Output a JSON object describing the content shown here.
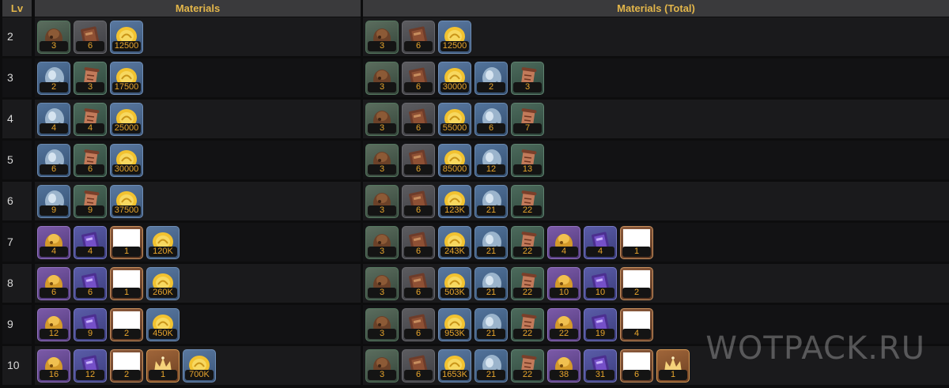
{
  "headers": {
    "lv": "Lv",
    "materials": "Materials",
    "total": "Materials (Total)"
  },
  "watermark": "WOTPACK.RU",
  "rows": [
    {
      "lv": "2",
      "materials": [
        [
          "bag",
          "3"
        ],
        [
          "book",
          "6"
        ],
        [
          "coin",
          "12500"
        ]
      ],
      "total": [
        [
          "bag",
          "3"
        ],
        [
          "book",
          "6"
        ],
        [
          "coin",
          "12500"
        ]
      ]
    },
    {
      "lv": "3",
      "materials": [
        [
          "scale",
          "2"
        ],
        [
          "scroll",
          "3"
        ],
        [
          "coin",
          "17500"
        ]
      ],
      "total": [
        [
          "bag",
          "3"
        ],
        [
          "book",
          "6"
        ],
        [
          "coin",
          "30000"
        ],
        [
          "scale",
          "2"
        ],
        [
          "scroll",
          "3"
        ]
      ]
    },
    {
      "lv": "4",
      "materials": [
        [
          "scale",
          "4"
        ],
        [
          "scroll",
          "4"
        ],
        [
          "coin",
          "25000"
        ]
      ],
      "total": [
        [
          "bag",
          "3"
        ],
        [
          "book",
          "6"
        ],
        [
          "coin",
          "55000"
        ],
        [
          "scale",
          "6"
        ],
        [
          "scroll",
          "7"
        ]
      ]
    },
    {
      "lv": "5",
      "materials": [
        [
          "scale",
          "6"
        ],
        [
          "scroll",
          "6"
        ],
        [
          "coin",
          "30000"
        ]
      ],
      "total": [
        [
          "bag",
          "3"
        ],
        [
          "book",
          "6"
        ],
        [
          "coin",
          "85000"
        ],
        [
          "scale",
          "12"
        ],
        [
          "scroll",
          "13"
        ]
      ]
    },
    {
      "lv": "6",
      "materials": [
        [
          "scale",
          "9"
        ],
        [
          "scroll",
          "9"
        ],
        [
          "coin",
          "37500"
        ]
      ],
      "total": [
        [
          "bag",
          "3"
        ],
        [
          "book",
          "6"
        ],
        [
          "coin",
          "123K"
        ],
        [
          "scale",
          "21"
        ],
        [
          "scroll",
          "22"
        ]
      ]
    },
    {
      "lv": "7",
      "materials": [
        [
          "goldbag",
          "4"
        ],
        [
          "tome",
          "4"
        ],
        [
          "blank",
          "1"
        ],
        [
          "coin",
          "120K"
        ]
      ],
      "total": [
        [
          "bag",
          "3"
        ],
        [
          "book",
          "6"
        ],
        [
          "coin",
          "243K"
        ],
        [
          "scale",
          "21"
        ],
        [
          "scroll",
          "22"
        ],
        [
          "goldbag",
          "4"
        ],
        [
          "tome",
          "4"
        ],
        [
          "blank",
          "1"
        ]
      ]
    },
    {
      "lv": "8",
      "materials": [
        [
          "goldbag",
          "6"
        ],
        [
          "tome",
          "6"
        ],
        [
          "blank",
          "1"
        ],
        [
          "coin",
          "260K"
        ]
      ],
      "total": [
        [
          "bag",
          "3"
        ],
        [
          "book",
          "6"
        ],
        [
          "coin",
          "503K"
        ],
        [
          "scale",
          "21"
        ],
        [
          "scroll",
          "22"
        ],
        [
          "goldbag",
          "10"
        ],
        [
          "tome",
          "10"
        ],
        [
          "blank",
          "2"
        ]
      ]
    },
    {
      "lv": "9",
      "materials": [
        [
          "goldbag",
          "12"
        ],
        [
          "tome",
          "9"
        ],
        [
          "blank",
          "2"
        ],
        [
          "coin",
          "450K"
        ]
      ],
      "total": [
        [
          "bag",
          "3"
        ],
        [
          "book",
          "6"
        ],
        [
          "coin",
          "953K"
        ],
        [
          "scale",
          "21"
        ],
        [
          "scroll",
          "22"
        ],
        [
          "goldbag",
          "22"
        ],
        [
          "tome",
          "19"
        ],
        [
          "blank",
          "4"
        ]
      ]
    },
    {
      "lv": "10",
      "materials": [
        [
          "goldbag",
          "16"
        ],
        [
          "tome",
          "12"
        ],
        [
          "blank",
          "2"
        ],
        [
          "crown",
          "1"
        ],
        [
          "coin",
          "700K"
        ]
      ],
      "total": [
        [
          "bag",
          "3"
        ],
        [
          "book",
          "6"
        ],
        [
          "coin",
          "1653K"
        ],
        [
          "scale",
          "21"
        ],
        [
          "scroll",
          "22"
        ],
        [
          "goldbag",
          "38"
        ],
        [
          "tome",
          "31"
        ],
        [
          "blank",
          "6"
        ],
        [
          "crown",
          "1"
        ]
      ]
    }
  ]
}
